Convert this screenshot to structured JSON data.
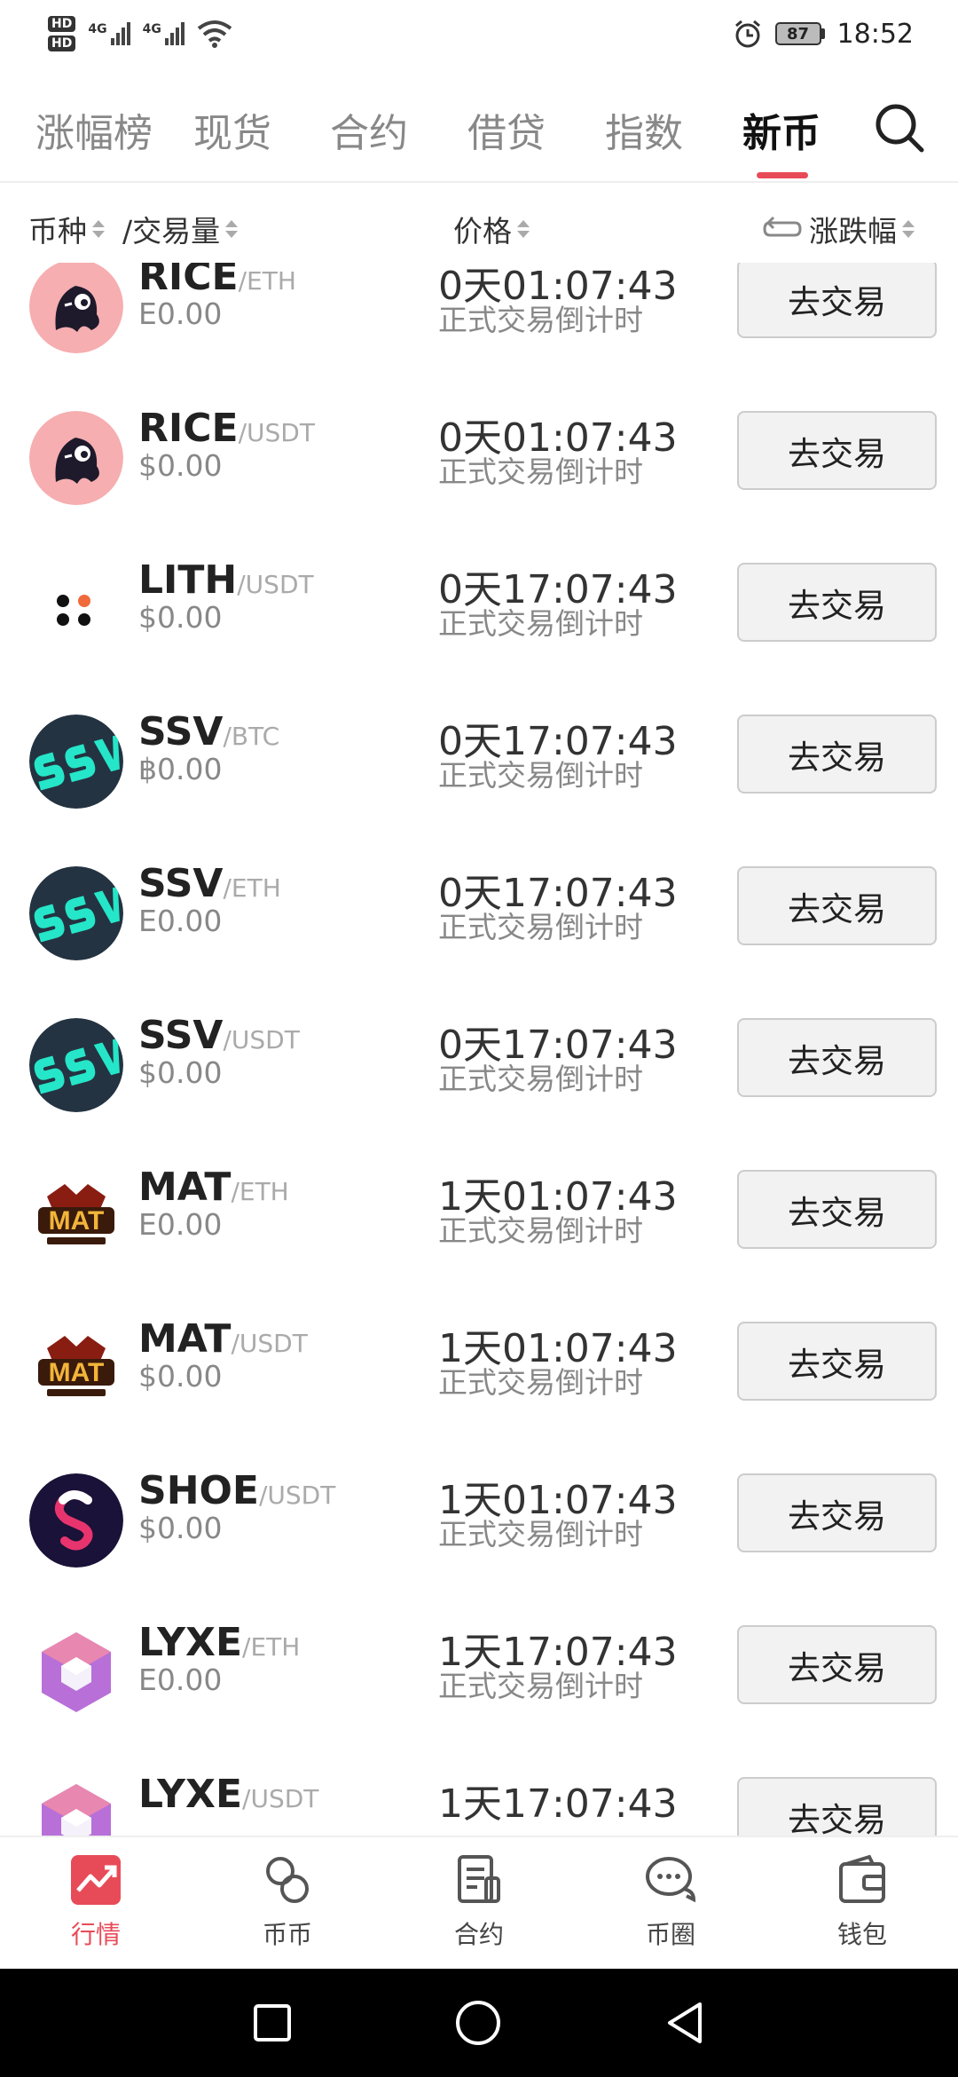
{
  "status_bar": {
    "hd1": "HD",
    "hd2": "HD",
    "net1": "4G",
    "net2": "4G",
    "battery": "87",
    "time": "18:52"
  },
  "tabs": [
    {
      "label": "涨幅榜",
      "active": false
    },
    {
      "label": "现货",
      "active": false
    },
    {
      "label": "合约",
      "active": false
    },
    {
      "label": "借贷",
      "active": false
    },
    {
      "label": "指数",
      "active": false
    },
    {
      "label": "新币",
      "active": true
    }
  ],
  "header": {
    "coin": "币种",
    "volume": "/交易量",
    "price": "价格",
    "change": "涨跌幅"
  },
  "rows": [
    {
      "base": "RICE",
      "quote": "/ETH",
      "volume": "E0.00",
      "time": "0天01:07:43",
      "countdown": "正式交易倒计时",
      "button": "去交易",
      "logo": "rice-logo"
    },
    {
      "base": "RICE",
      "quote": "/USDT",
      "volume": "$0.00",
      "time": "0天01:07:43",
      "countdown": "正式交易倒计时",
      "button": "去交易",
      "logo": "rice-logo"
    },
    {
      "base": "LITH",
      "quote": "/USDT",
      "volume": "$0.00",
      "time": "0天17:07:43",
      "countdown": "正式交易倒计时",
      "button": "去交易",
      "logo": "lith-logo"
    },
    {
      "base": "SSV",
      "quote": "/BTC",
      "volume": "฿0.00",
      "time": "0天17:07:43",
      "countdown": "正式交易倒计时",
      "button": "去交易",
      "logo": "ssv-logo"
    },
    {
      "base": "SSV",
      "quote": "/ETH",
      "volume": "E0.00",
      "time": "0天17:07:43",
      "countdown": "正式交易倒计时",
      "button": "去交易",
      "logo": "ssv-logo"
    },
    {
      "base": "SSV",
      "quote": "/USDT",
      "volume": "$0.00",
      "time": "0天17:07:43",
      "countdown": "正式交易倒计时",
      "button": "去交易",
      "logo": "ssv-logo"
    },
    {
      "base": "MAT",
      "quote": "/ETH",
      "volume": "E0.00",
      "time": "1天01:07:43",
      "countdown": "正式交易倒计时",
      "button": "去交易",
      "logo": "mat-logo"
    },
    {
      "base": "MAT",
      "quote": "/USDT",
      "volume": "$0.00",
      "time": "1天01:07:43",
      "countdown": "正式交易倒计时",
      "button": "去交易",
      "logo": "mat-logo"
    },
    {
      "base": "SHOE",
      "quote": "/USDT",
      "volume": "$0.00",
      "time": "1天01:07:43",
      "countdown": "正式交易倒计时",
      "button": "去交易",
      "logo": "shoe-logo"
    },
    {
      "base": "LYXE",
      "quote": "/ETH",
      "volume": "E0.00",
      "time": "1天17:07:43",
      "countdown": "正式交易倒计时",
      "button": "去交易",
      "logo": "lyxe-logo"
    },
    {
      "base": "LYXE",
      "quote": "/USDT",
      "volume": "",
      "time": "1天17:07:43",
      "countdown": "",
      "button": "去交易",
      "logo": "lyxe-logo"
    }
  ],
  "bottom_nav": [
    {
      "label": "行情",
      "icon": "chart-icon",
      "active": true
    },
    {
      "label": "币币",
      "icon": "exchange-icon",
      "active": false
    },
    {
      "label": "合约",
      "icon": "document-icon",
      "active": false
    },
    {
      "label": "币圈",
      "icon": "chat-icon",
      "active": false
    },
    {
      "label": "钱包",
      "icon": "wallet-icon",
      "active": false
    }
  ],
  "colors": {
    "accent": "#e84b58"
  }
}
